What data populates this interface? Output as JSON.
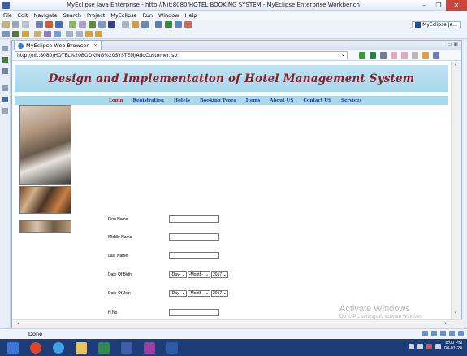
{
  "window": {
    "title": "MyEclipse Java Enterprise - http://Nit:8080/HOTEL BOOKING SYSTEM - MyEclipse Enterprise Workbench",
    "minimize": "–",
    "maximize": "❐",
    "close": "✕"
  },
  "menu": {
    "items": [
      "File",
      "Edit",
      "Navigate",
      "Search",
      "Project",
      "MyEclipse",
      "Run",
      "Window",
      "Help"
    ]
  },
  "perspective": {
    "label": "MyEclipse Ja..."
  },
  "editor": {
    "tab_label": "MyEclipse Web Browser",
    "tab_close": "✕",
    "url": "http://nit:8080/HOTEL%20BOOKING%20SYSTEM/AddCustomer.jsp"
  },
  "site": {
    "banner_title": "Design and Implementation of Hotel Management System",
    "nav": [
      "Login",
      "Registration",
      "Hotels",
      "Booking Types",
      "Items",
      "About US",
      "Contact US",
      "Services"
    ]
  },
  "form": {
    "first_name": "First Name",
    "middle_name": "Middle Name",
    "last_name": "Last Name",
    "date_of_birth": "Date Of Birth",
    "date_of_join": "Date Of Join",
    "hno": "H.No",
    "day_placeholder": "-Day-",
    "month_placeholder": "-Month-",
    "year_value": "2017"
  },
  "watermark": {
    "line1": "Activate Windows",
    "line2": "Go to PC settings to activate Windows."
  },
  "status": {
    "text": "Done"
  },
  "taskbar": {
    "time": "8:00 PM",
    "date": "08-01-20"
  },
  "colors": {
    "banner_bg": "#a7d8ec",
    "banner_text": "#8a1f2b",
    "nav_text": "#2b3f9c",
    "taskbar": "#1c3d78"
  }
}
